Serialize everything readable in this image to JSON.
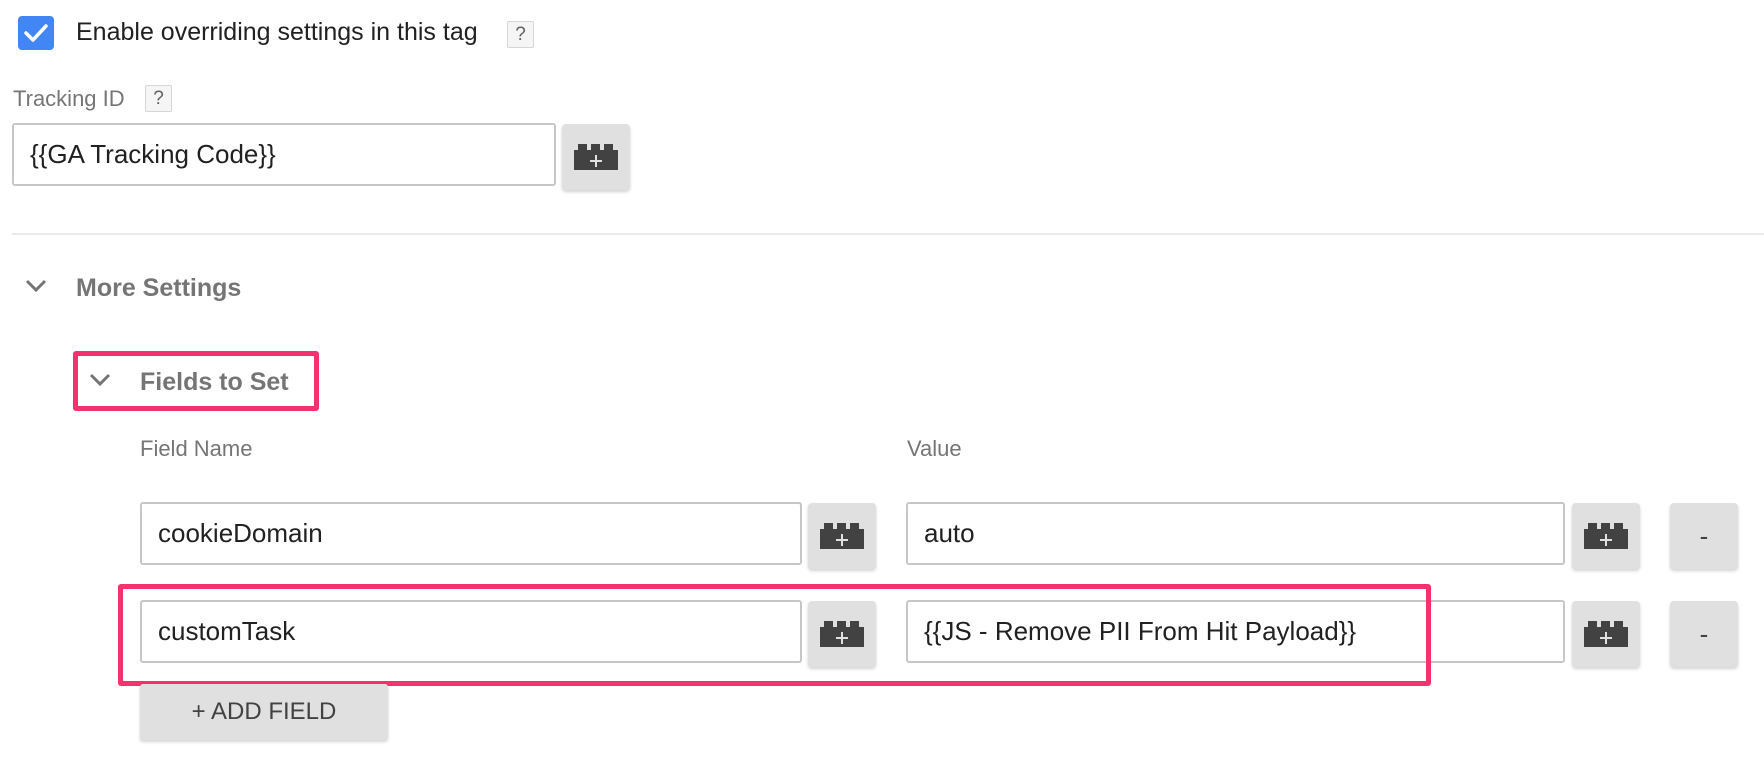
{
  "override": {
    "checked": true,
    "label": "Enable overriding settings in this tag",
    "help": "?"
  },
  "tracking": {
    "label": "Tracking ID",
    "help": "?",
    "value": "{{GA Tracking Code}}"
  },
  "more_settings": {
    "title": "More Settings",
    "expanded": true
  },
  "fields_to_set": {
    "title": "Fields to Set",
    "expanded": true,
    "columns": {
      "name": "Field Name",
      "value": "Value"
    },
    "rows": [
      {
        "name": "cookieDomain",
        "value": "auto",
        "remove_label": "-"
      },
      {
        "name": "customTask",
        "value": "{{JS - Remove PII From Hit Payload}}",
        "remove_label": "-"
      }
    ],
    "add_label": "+ ADD FIELD"
  },
  "colors": {
    "accent": "#4285f4",
    "highlight": "#f4326e",
    "button_bg": "#e0e0e0",
    "muted_text": "#757575"
  }
}
